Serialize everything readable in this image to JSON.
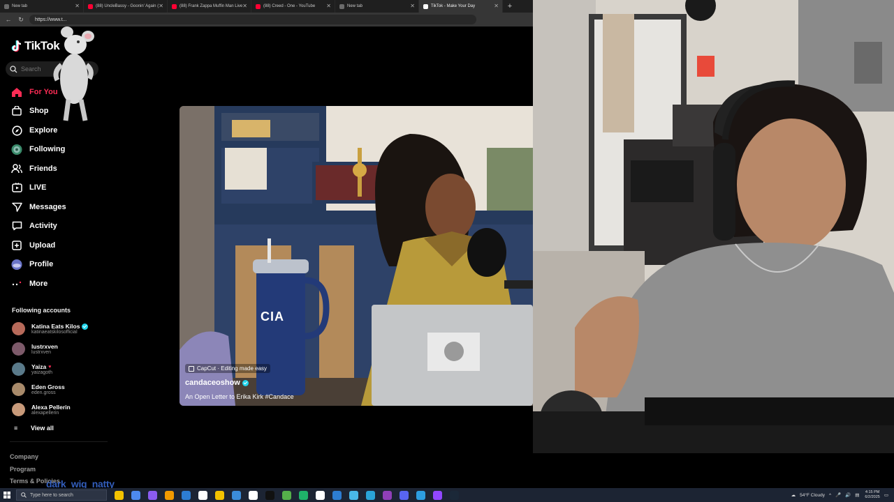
{
  "browser": {
    "tabs": [
      {
        "title": "New tab",
        "fav_color": "#6b6b6b",
        "active": false
      },
      {
        "title": "(88) UncleBassy - Goonin' Again (",
        "fav_color": "#ff0033",
        "active": false
      },
      {
        "title": "(88) Frank Zappa Muffin Man Live",
        "fav_color": "#ff0033",
        "active": false
      },
      {
        "title": "(88) Creed - One - YouTube",
        "fav_color": "#ff0033",
        "active": false
      },
      {
        "title": "New tab",
        "fav_color": "#6b6b6b",
        "active": false
      },
      {
        "title": "TikTok - Make Your Day",
        "fav_color": "#ffffff",
        "active": true
      }
    ],
    "new_tab_symbol": "+",
    "url": "https://www.t..."
  },
  "tiktok": {
    "logo_text": "TikTok",
    "search_placeholder": "Search",
    "nav": [
      {
        "label": "For You",
        "icon": "home-icon",
        "active": true
      },
      {
        "label": "Shop",
        "icon": "shop-icon",
        "active": false
      },
      {
        "label": "Explore",
        "icon": "compass-icon",
        "active": false
      },
      {
        "label": "Following",
        "icon": "following-avatar-icon",
        "active": false
      },
      {
        "label": "Friends",
        "icon": "friends-icon",
        "active": false
      },
      {
        "label": "LIVE",
        "icon": "live-icon",
        "active": false
      },
      {
        "label": "Messages",
        "icon": "messages-icon",
        "active": false
      },
      {
        "label": "Activity",
        "icon": "activity-icon",
        "active": false
      },
      {
        "label": "Upload",
        "icon": "upload-icon",
        "active": false
      },
      {
        "label": "Profile",
        "icon": "profile-avatar-icon",
        "active": false
      },
      {
        "label": "More",
        "icon": "more-icon",
        "active": false
      }
    ],
    "following_header": "Following accounts",
    "accounts": [
      {
        "name": "Katina Eats Kilos",
        "user": "katinaeatskilosofficial",
        "verified": true,
        "color": "#b76a5a"
      },
      {
        "name": "lustrxven",
        "user": "lustrxven",
        "verified": false,
        "color": "#7d5a6a"
      },
      {
        "name": "Yaiza",
        "user": "yaizagoth",
        "verified": false,
        "color": "#5a7a8a"
      },
      {
        "name": "Eden Gross",
        "user": "eden.gross",
        "verified": false,
        "color": "#a88a6a"
      },
      {
        "name": "Alexa Pellerin",
        "user": "alexapellerin",
        "verified": false,
        "color": "#c89a7a"
      }
    ],
    "view_all": "View all",
    "footer_links": [
      "Company",
      "Program",
      "Terms & Policies"
    ],
    "overlay_watermark": "dark_wig_natty",
    "video": {
      "capcut": "CapCut · Editing made easy",
      "author": "candaceoshow",
      "verified": true,
      "description": "An Open Letter to Erika Kirk #Candace",
      "mug_text": "CIA"
    }
  },
  "taskbar": {
    "search_placeholder": "Type here to search",
    "apps": [
      "#f2c200",
      "#4d8af0",
      "#8a5cf0",
      "#f29a00",
      "#2d7dd2",
      "#ffffff",
      "#f2c200",
      "#3b8cd9",
      "#ffffff",
      "#111111",
      "#55b04a",
      "#1fb26a",
      "#ffffff",
      "#2d7dd2",
      "#49b8e8",
      "#2aa4d8",
      "#8f3fb8",
      "#5865f2",
      "#2d9ee0",
      "#9147ff",
      "#1b2838"
    ],
    "weather": "54°F Cloudy",
    "time": "4:15 PM",
    "date": "6/2/2025"
  },
  "colors": {
    "tiktok_red": "#fe2c55",
    "verified_blue": "#20d5ec"
  }
}
